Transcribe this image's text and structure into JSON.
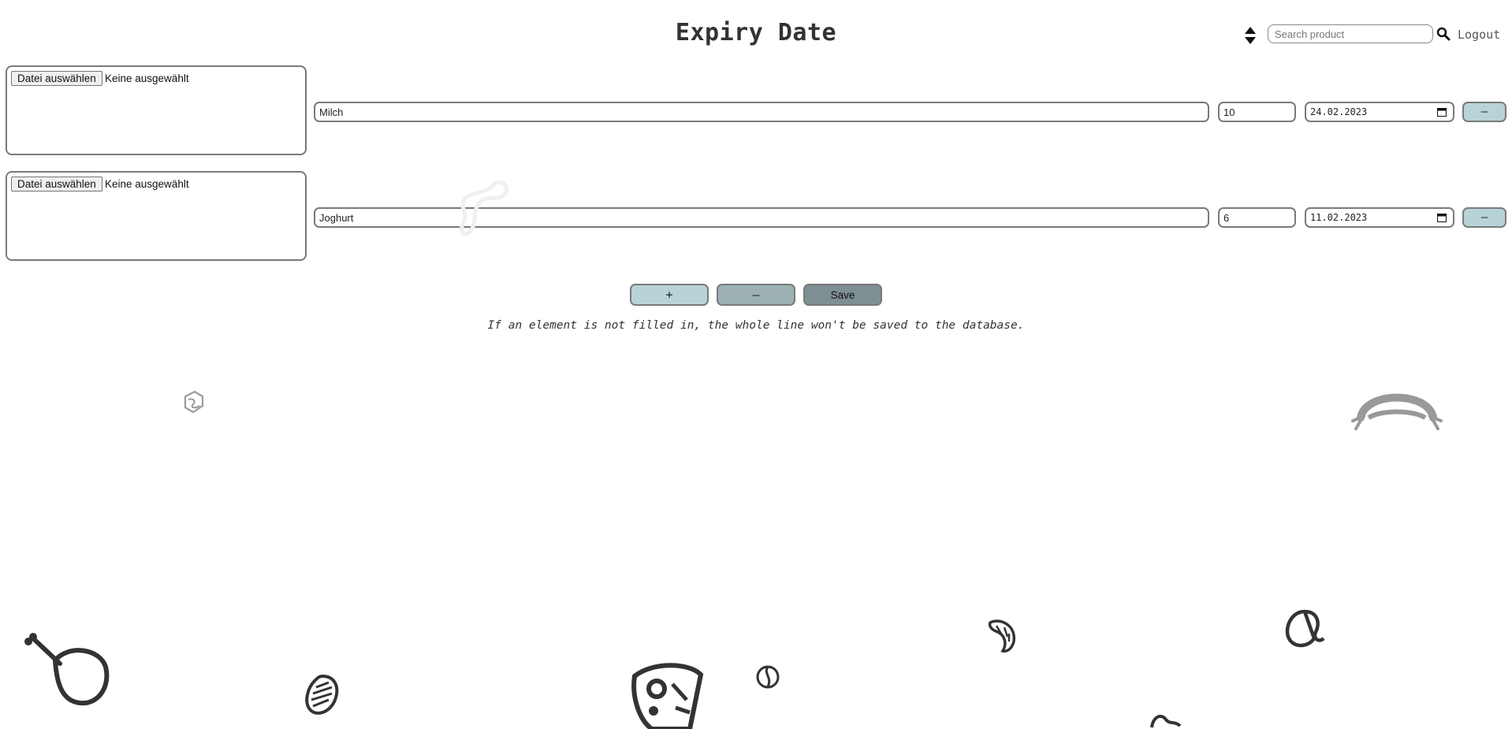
{
  "header": {
    "title": "Expiry Date",
    "search_placeholder": "Search product",
    "search_value": "",
    "logout_label": "Logout",
    "sort_icon": "sort-updown-icon",
    "search_icon": "magnifier-icon"
  },
  "rows": [
    {
      "file_button_label": "Datei auswählen",
      "file_status": "Keine ausgewählt",
      "name": "Milch",
      "quantity": "10",
      "expiry_date": "24.02.2023",
      "remove_label": "–"
    },
    {
      "file_button_label": "Datei auswählen",
      "file_status": "Keine ausgewählt",
      "name": "Joghurt",
      "quantity": "6",
      "expiry_date": "11.02.2023",
      "remove_label": "–"
    }
  ],
  "controls": {
    "add_label": "+",
    "remove_label": "–",
    "save_label": "Save"
  },
  "notice": "If an element is not filled in, the whole line won't be saved to the database.",
  "colors": {
    "accent_light": "#b7d3d8",
    "accent_mid": "#9cb0b4",
    "accent_dark": "#7e8f93",
    "border": "#7a7a7a"
  },
  "decorations": [
    "chicken-leg-icon",
    "sausage-icon",
    "cheese-icon",
    "croissant-icon",
    "tomato-icon",
    "bread-icon",
    "candy-icon",
    "ham-icon",
    "pepper-icon",
    "nut-icon"
  ]
}
